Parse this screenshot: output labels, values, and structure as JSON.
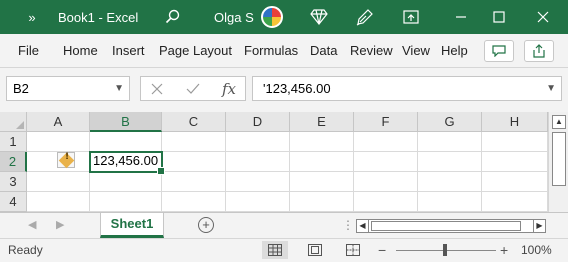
{
  "titlebar": {
    "qat_more": "»",
    "title": "Book1  -  Excel",
    "user": "Olga S"
  },
  "menu": {
    "tabs": [
      "File",
      "Home",
      "Insert",
      "Page Layout",
      "Formulas",
      "Data",
      "Review",
      "View",
      "Help"
    ]
  },
  "formula_bar": {
    "name_box": "B2",
    "fx_label": "fx",
    "formula": "'123,456.00"
  },
  "grid": {
    "columns": [
      "A",
      "B",
      "C",
      "D",
      "E",
      "F",
      "G",
      "H"
    ],
    "rows": [
      "1",
      "2",
      "3",
      "4"
    ],
    "selected_cell": "B2",
    "cells": {
      "B2": "123,456.00"
    },
    "error_indicator": "!"
  },
  "sheets": {
    "tabs": [
      "Sheet1"
    ],
    "active": "Sheet1",
    "add_label": "+"
  },
  "status": {
    "text": "Ready",
    "zoom": "100%",
    "zoom_minus": "−",
    "zoom_plus": "+"
  },
  "colors": {
    "excel_green": "#217346",
    "warning": "#e9b24a"
  }
}
